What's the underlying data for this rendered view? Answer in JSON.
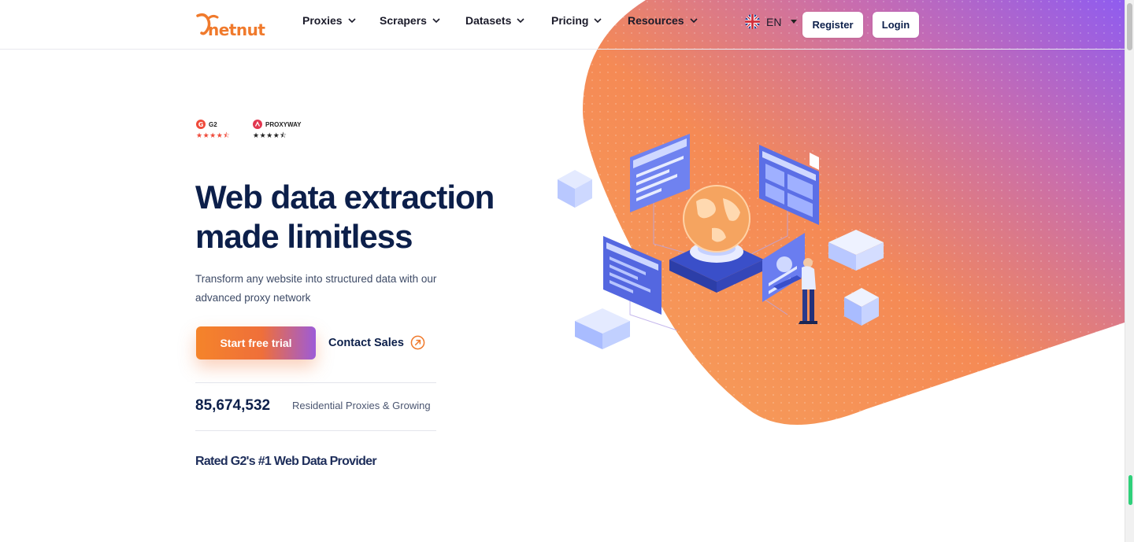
{
  "brand": {
    "name": "netnut",
    "accent": "#f07a2c",
    "purple": "#8b5cf6"
  },
  "nav": {
    "items": [
      {
        "label": "Proxies"
      },
      {
        "label": "Scrapers"
      },
      {
        "label": "Datasets"
      },
      {
        "label": "Pricing"
      },
      {
        "label": "Resources"
      }
    ],
    "language": "EN",
    "register_label": "Register",
    "login_label": "Login"
  },
  "ratings": [
    {
      "label": "G2",
      "stars": "★★★★⯪",
      "star_color": "#ef4a3a"
    },
    {
      "label": "PROXYWAY",
      "stars": "★★★★⯪",
      "star_color": "#222222"
    }
  ],
  "hero": {
    "headline_line1": "Web data extraction",
    "headline_line2": "made limitless",
    "subtext": "Transform any website into structured data with our advanced proxy network",
    "cta_label": "Start free trial",
    "contact_label": "Contact Sales"
  },
  "stats": {
    "value": "85,674,532",
    "label": "Residential Proxies & Growing"
  },
  "rated_text": "Rated G2's #1 Web Data Provider",
  "icons": [
    "netnut-logo",
    "chevron-down-icon",
    "uk-flag-icon",
    "arrow-up-right-circle-icon",
    "g2-logo",
    "proxyway-logo"
  ]
}
